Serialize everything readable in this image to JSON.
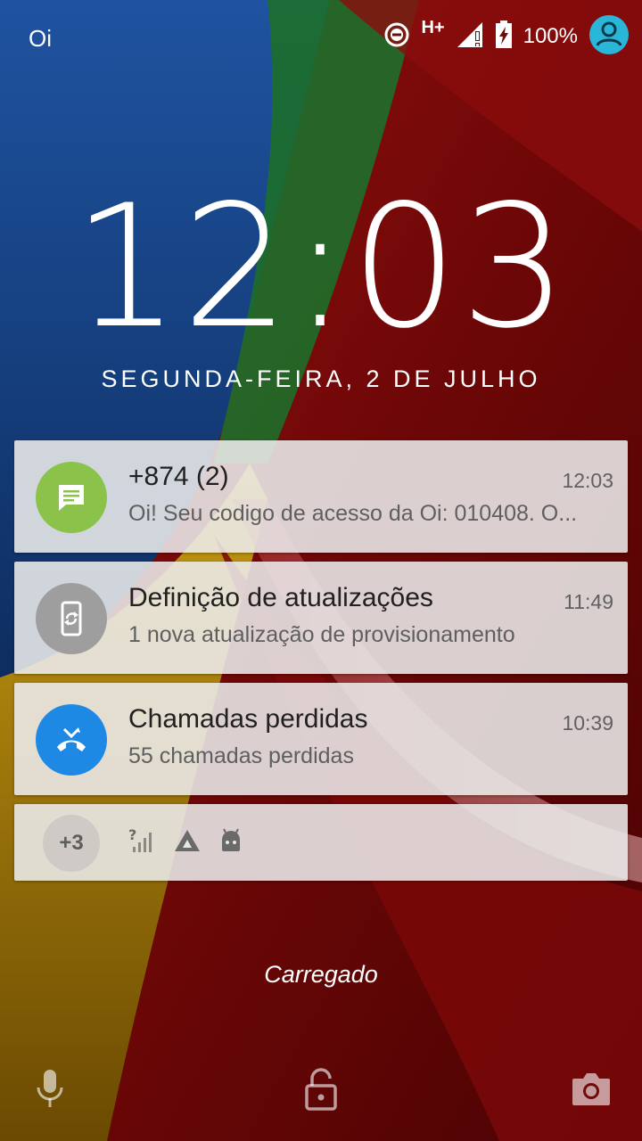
{
  "status_bar": {
    "carrier": "Oi",
    "network_type": "H+",
    "battery": "100%",
    "icons": [
      "dnd-icon",
      "mobile-signal-icon",
      "battery-charging-icon",
      "user-avatar-icon"
    ]
  },
  "lock_screen": {
    "time": "12:03",
    "date": "SEGUNDA-FEIRA, 2 DE JULHO",
    "charging_status": "Carregado"
  },
  "notifications": [
    {
      "icon": "message-icon",
      "color": "#8bc34a",
      "title": "+874 (2)",
      "time": "12:03",
      "text": "Oi! Seu codigo de acesso da Oi: 010408. O..."
    },
    {
      "icon": "phone-sync-icon",
      "color": "#9e9e9e",
      "title": "Definição de atualizações",
      "time": "11:49",
      "text": "1 nova atualização de provisionamento"
    },
    {
      "icon": "missed-call-icon",
      "color": "#1e88e5",
      "title": "Chamadas perdidas",
      "time": "10:39",
      "text": "55 chamadas perdidas"
    }
  ],
  "more_notifications": {
    "count_label": "+3",
    "icons": [
      "no-signal-icon",
      "triangle-app-icon",
      "android-icon"
    ]
  },
  "bottom_actions": [
    "microphone-icon",
    "unlock-icon",
    "camera-icon"
  ]
}
